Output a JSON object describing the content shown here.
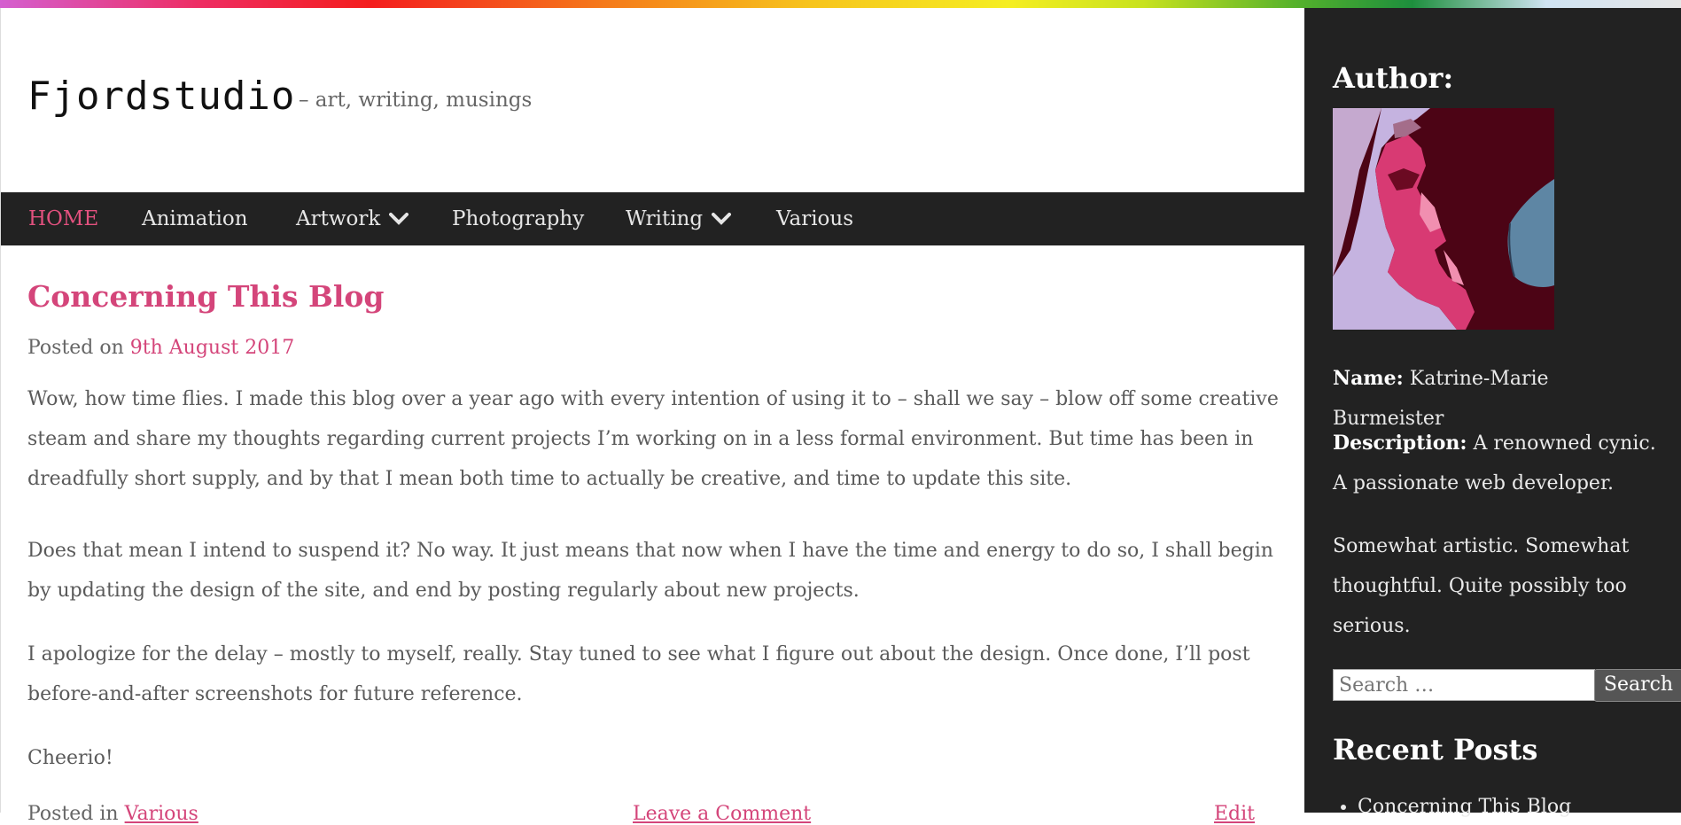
{
  "site": {
    "title": "Fjordstudio",
    "tagline": "– art, writing, musings"
  },
  "nav": {
    "items": [
      {
        "label": "HOME"
      },
      {
        "label": "Animation"
      },
      {
        "label": "Artwork"
      },
      {
        "label": "Photography"
      },
      {
        "label": "Writing"
      },
      {
        "label": "Various"
      }
    ]
  },
  "post": {
    "title": "Concerning This Blog",
    "posted_prefix": "Posted on",
    "date": "9th August 2017",
    "paragraphs": [
      "Wow, how time flies. I made this blog over a year ago with every intention of using it to – shall we say – blow off some creative steam and share my thoughts regarding current projects I’m working on in a less formal environment. But time has been in dreadfully short supply, and by that I mean both time to actually be creative, and time to update this site.",
      "Does that mean I intend to suspend it? No way. It just means that now when I have the time and energy to do so, I shall begin by updating the design of the site, and end by posting regularly about new projects.",
      "I apologize for the delay – mostly to myself, really. Stay tuned to see what I figure out about the design. Once done, I’ll post before-and-after screenshots for future reference.",
      "Cheerio!"
    ],
    "footer": {
      "posted_in_prefix": "Posted in",
      "category": "Various",
      "comment": "Leave a Comment",
      "edit": "Edit"
    }
  },
  "sidebar": {
    "author_heading": "Author:",
    "name_label": "Name:",
    "name_value": "Katrine-Marie Burmeister",
    "desc_label": "Description:",
    "desc_value": "A renowned cynic. A passionate web developer.",
    "bio": "Somewhat artistic. Somewhat thoughtful. Quite possibly too serious.",
    "search_placeholder": "Search …",
    "search_button": "Search",
    "recent_heading": "Recent Posts",
    "recent_posts": [
      "Concerning This Blog"
    ]
  },
  "colors": {
    "accent": "#d4457a",
    "nav_bg": "#222222",
    "sidebar_bg": "#222222"
  }
}
